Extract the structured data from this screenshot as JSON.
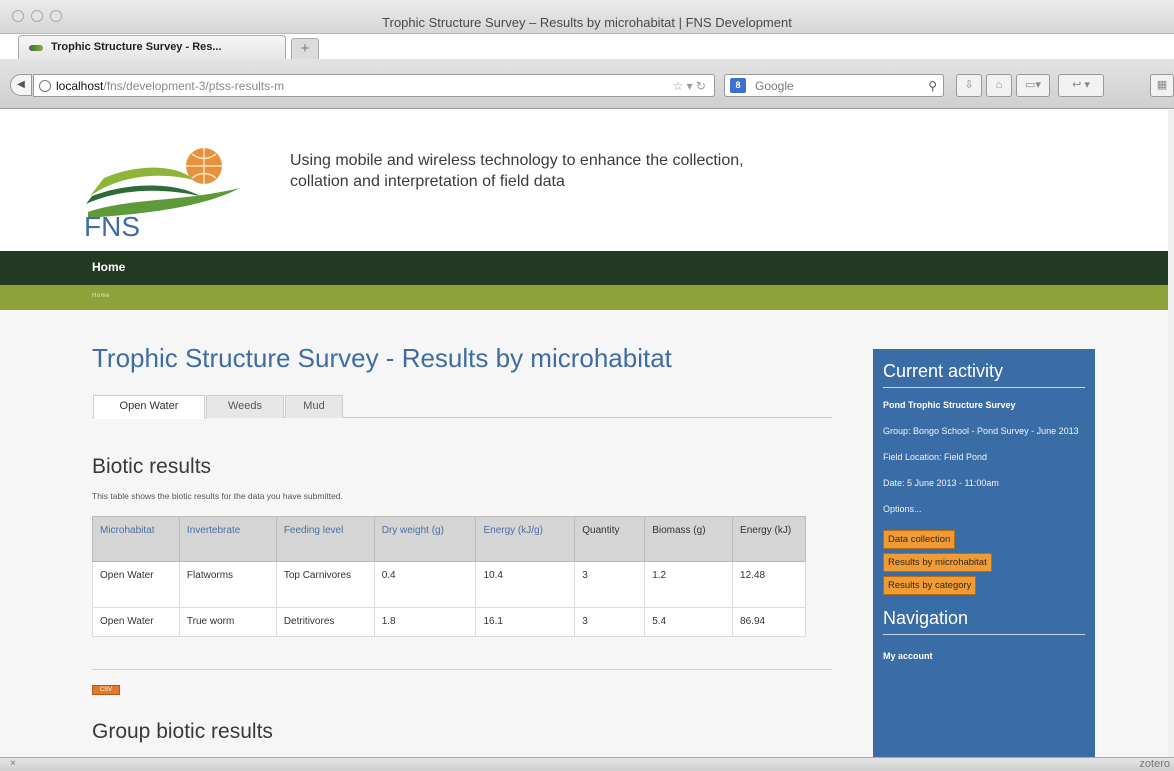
{
  "browser": {
    "window_title": "Trophic Structure Survey – Results by microhabitat | FNS Development",
    "tab_label": "Trophic Structure Survey - Res...",
    "new_tab_symbol": "+",
    "url_host": "localhost",
    "url_path": "/fns/development-3/ptss-results-m",
    "search_placeholder": "Google",
    "search_badge": "8"
  },
  "site": {
    "logo_text": "FNS",
    "slogan": "Using mobile and wireless technology to enhance the collection, collation and interpretation of field data",
    "main_nav": {
      "home": "Home"
    },
    "breadcrumb": "Home"
  },
  "main": {
    "title": "Trophic Structure Survey - Results by microhabitat",
    "tabs": [
      "Open Water",
      "Weeds",
      "Mud"
    ],
    "biotic": {
      "title": "Biotic results",
      "intro": "This table shows the biotic results for the data you have submitted.",
      "columns": [
        "Microhabitat",
        "Invertebrate",
        "Feeding level",
        "Dry weight (g)",
        "Energy (kJ/g)",
        "Quantity",
        "Biomass (g)",
        "Energy (kJ)"
      ],
      "rows": [
        [
          "Open Water",
          "Flatworms",
          "Top Carnivores",
          "0.4",
          "10.4",
          "3",
          "1.2",
          "12.48"
        ],
        [
          "Open Water",
          "True worm",
          "Detritivores",
          "1.8",
          "16.1",
          "3",
          "5.4",
          "86.94"
        ]
      ],
      "export_label": "CSV"
    },
    "group_title": "Group biotic results"
  },
  "sidebar": {
    "activity_title": "Current activity",
    "survey": "Pond Trophic Structure Survey",
    "group": "Group: Bongo School - Pond Survey - June 2013",
    "location": "Field Location: Field Pond",
    "date": "Date: 5 June 2013 - 11:00am",
    "options": "Options...",
    "buttons": [
      "Data collection",
      "Results by microhabitat",
      "Results by category"
    ],
    "nav_title": "Navigation",
    "nav_items": [
      "My account"
    ]
  },
  "status": {
    "close": "×",
    "addon": "zotero"
  },
  "colors": {
    "nav_dark": "#223a21",
    "nav_olive": "#8da239",
    "sidebar_blue": "#3a6ca5",
    "accent_orange": "#f39b33",
    "title_blue": "#3f6da1"
  }
}
